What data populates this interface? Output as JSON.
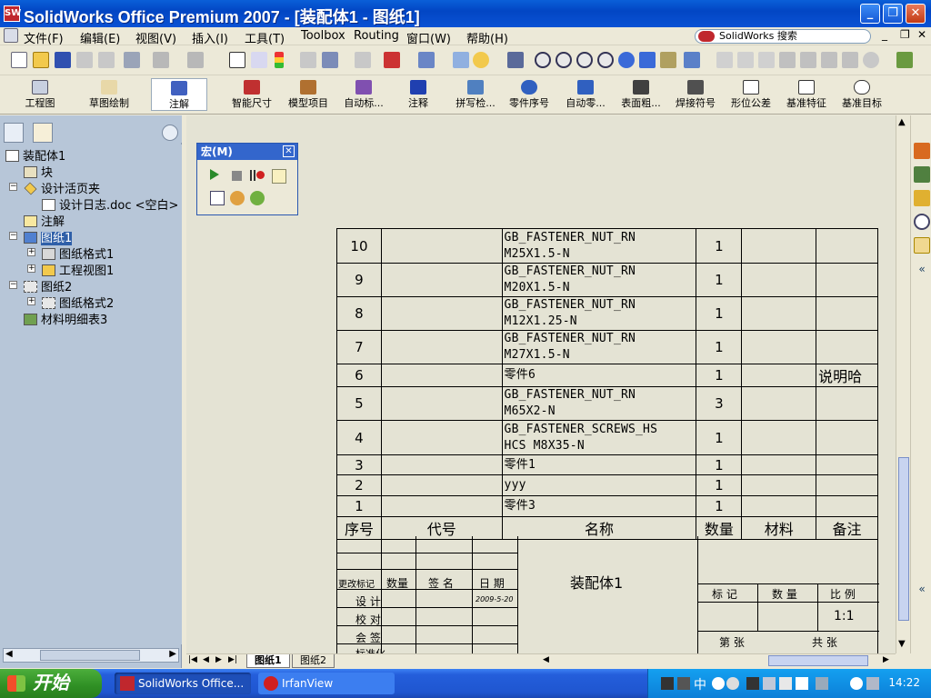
{
  "window": {
    "title": "SolidWorks Office Premium 2007 - [装配体1 - 图纸1]",
    "app_icon_text": "SW"
  },
  "menu": [
    "文件(F)",
    "编辑(E)",
    "视图(V)",
    "插入(I)",
    "工具(T)",
    "Toolbox",
    "Routing",
    "窗口(W)",
    "帮助(H)"
  ],
  "search": {
    "label": "SolidWorks 搜索"
  },
  "command_manager": {
    "left": [
      "工程图",
      "草图绘制",
      "注解"
    ],
    "tools": [
      "智能尺寸",
      "模型项目",
      "自动标...",
      "注释",
      "拼写检...",
      "零件序号",
      "自动零...",
      "表面粗...",
      "焊接符号",
      "形位公差",
      "基准特征",
      "基准目标"
    ]
  },
  "tree": {
    "root": "装配体1",
    "items": [
      "块",
      "设计活页夹",
      "设计日志.doc <空白>",
      "注解",
      "图纸1",
      "图纸格式1",
      "工程视图1",
      "图纸2",
      "图纸格式2",
      "材料明细表3"
    ]
  },
  "macro": {
    "title": "宏(M)"
  },
  "bom": {
    "rows": [
      {
        "no": "10",
        "code": "",
        "name_line1": "GB_FASTENER_NUT_RN",
        "name_line2": "M25X1.5-N",
        "qty": "1",
        "material": "",
        "note": ""
      },
      {
        "no": "9",
        "code": "",
        "name_line1": "GB_FASTENER_NUT_RN",
        "name_line2": "M20X1.5-N",
        "qty": "1",
        "material": "",
        "note": ""
      },
      {
        "no": "8",
        "code": "",
        "name_line1": "GB_FASTENER_NUT_RN",
        "name_line2": "M12X1.25-N",
        "qty": "1",
        "material": "",
        "note": ""
      },
      {
        "no": "7",
        "code": "",
        "name_line1": "GB_FASTENER_NUT_RN",
        "name_line2": "M27X1.5-N",
        "qty": "1",
        "material": "",
        "note": ""
      },
      {
        "no": "6",
        "code": "",
        "name_line1": "零件6",
        "name_line2": "",
        "qty": "1",
        "material": "",
        "note": "说明哈"
      },
      {
        "no": "5",
        "code": "",
        "name_line1": "GB_FASTENER_NUT_RN",
        "name_line2": "M65X2-N",
        "qty": "3",
        "material": "",
        "note": ""
      },
      {
        "no": "4",
        "code": "",
        "name_line1": "GB_FASTENER_SCREWS_HS",
        "name_line2": "HCS M8X35-N",
        "qty": "1",
        "material": "",
        "note": ""
      },
      {
        "no": "3",
        "code": "",
        "name_line1": "零件1",
        "name_line2": "",
        "qty": "1",
        "material": "",
        "note": ""
      },
      {
        "no": "2",
        "code": "",
        "name_line1": "yyy",
        "name_line2": "",
        "qty": "1",
        "material": "",
        "note": ""
      },
      {
        "no": "1",
        "code": "",
        "name_line1": "零件3",
        "name_line2": "",
        "qty": "1",
        "material": "",
        "note": ""
      }
    ],
    "headers": [
      "序号",
      "代号",
      "名称",
      "数量",
      "材料",
      "备注"
    ]
  },
  "title_block": {
    "assembly_name": "装配体1",
    "rev_label": "更改标记",
    "qty_label": "数量",
    "sign_label": "签 名",
    "date_label": "日 期",
    "design_label": "设 计",
    "check_label": "校 对",
    "countersign_label": "会 签",
    "std_label": "标准化",
    "date_value": "2009-5-20",
    "mark_label": "标 记",
    "count_label": "数 量",
    "scale_label": "比 例",
    "scale_value": "1:1",
    "sheet_label": "第   张",
    "total_label": "共   张"
  },
  "sheet_tabs": [
    "图纸1",
    "图纸2"
  ],
  "taskbar": {
    "start": "开始",
    "items": [
      "SolidWorks Office...",
      "IrfanView"
    ],
    "tray_ime": "中",
    "clock": "14:22"
  }
}
